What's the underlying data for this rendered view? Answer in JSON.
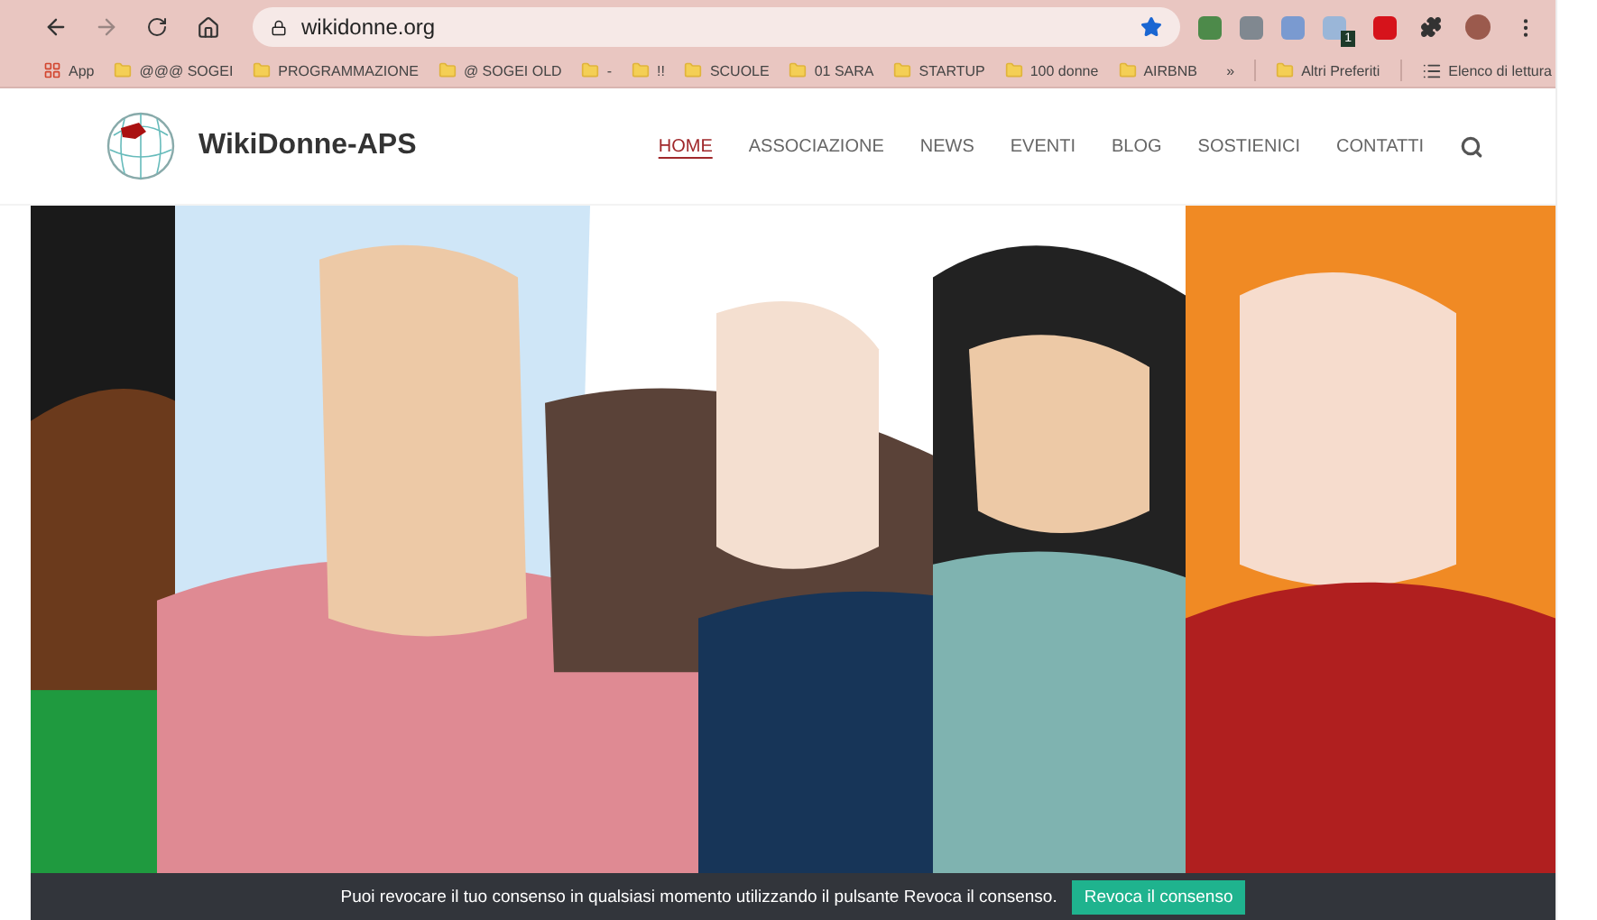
{
  "browser": {
    "address": "wikidonne.org",
    "bookmarks": [
      {
        "label": "App",
        "kind": "apps"
      },
      {
        "label": "@@@ SOGEI",
        "kind": "folder"
      },
      {
        "label": "PROGRAMMAZIONE",
        "kind": "folder"
      },
      {
        "label": "@ SOGEI OLD",
        "kind": "folder"
      },
      {
        "label": "-",
        "kind": "folder"
      },
      {
        "label": "!!",
        "kind": "folder"
      },
      {
        "label": "SCUOLE",
        "kind": "folder"
      },
      {
        "label": "01 SARA",
        "kind": "folder"
      },
      {
        "label": "STARTUP",
        "kind": "folder"
      },
      {
        "label": "100 donne",
        "kind": "folder"
      },
      {
        "label": "AIRBNB",
        "kind": "folder"
      }
    ],
    "overflow": "»",
    "other_bookmarks": "Altri Preferiti",
    "reading_list": "Elenco di lettura",
    "extension_badge": "1"
  },
  "site": {
    "brand": "WikiDonne-APS",
    "nav": [
      {
        "label": "HOME",
        "selected": true
      },
      {
        "label": "ASSOCIAZIONE",
        "selected": false
      },
      {
        "label": "NEWS",
        "selected": false
      },
      {
        "label": "EVENTI",
        "selected": false
      },
      {
        "label": "BLOG",
        "selected": false
      },
      {
        "label": "SOSTIENICI",
        "selected": false
      },
      {
        "label": "CONTATTI",
        "selected": false
      }
    ]
  },
  "consent": {
    "text": "Puoi revocare il tuo consenso in qualsiasi momento utilizzando il pulsante Revoca il consenso.",
    "button": "Revoca il consenso"
  }
}
